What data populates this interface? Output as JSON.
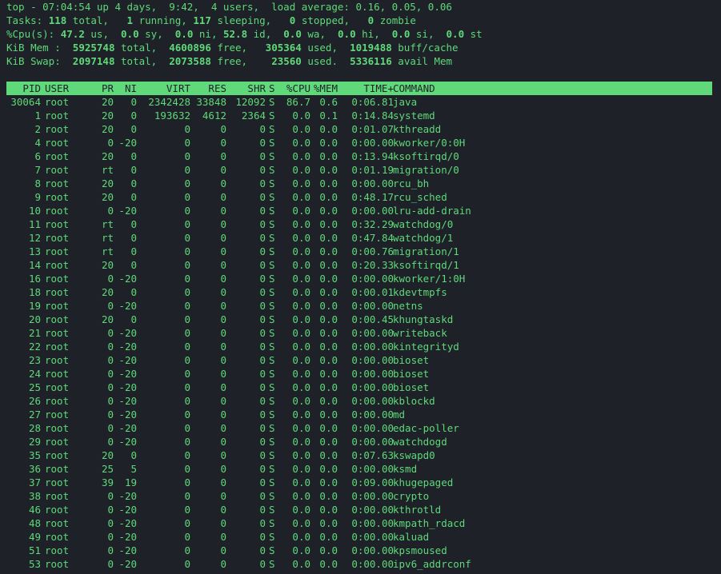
{
  "summary": {
    "uptime_line": "top - 07:04:54 up 4 days,  9:42,  4 users,  load average: 0.16, 0.05, 0.06",
    "tasks": {
      "label": "Tasks:",
      "total": "118",
      "total_label": "total,",
      "running": "1",
      "running_label": "running,",
      "sleeping": "117",
      "sleeping_label": "sleeping,",
      "stopped": "0",
      "stopped_label": "stopped,",
      "zombie": "0",
      "zombie_label": "zombie"
    },
    "cpu": {
      "label": "%Cpu(s):",
      "us": "47.2",
      "us_label": "us,",
      "sy": "0.0",
      "sy_label": "sy,",
      "ni": "0.0",
      "ni_label": "ni,",
      "id": "52.8",
      "id_label": "id,",
      "wa": "0.0",
      "wa_label": "wa,",
      "hi": "0.0",
      "hi_label": "hi,",
      "si": "0.0",
      "si_label": "si,",
      "st": "0.0",
      "st_label": "st"
    },
    "mem": {
      "label": "KiB Mem :",
      "total": "5925748",
      "total_label": "total,",
      "free": "4600896",
      "free_label": "free,",
      "used": "305364",
      "used_label": "used,",
      "buff": "1019488",
      "buff_label": "buff/cache"
    },
    "swap": {
      "label": "KiB Swap:",
      "total": "2097148",
      "total_label": "total,",
      "free": "2073588",
      "free_label": "free,",
      "used": "23560",
      "used_label": "used.",
      "avail": "5336116",
      "avail_label": "avail Mem"
    }
  },
  "columns": [
    "PID",
    "USER",
    "PR",
    "NI",
    "VIRT",
    "RES",
    "SHR",
    "S",
    "%CPU",
    "%MEM",
    "TIME+",
    "COMMAND"
  ],
  "processes": [
    [
      "30064",
      "root",
      "20",
      "0",
      "2342428",
      "33848",
      "12092",
      "S",
      "86.7",
      "0.6",
      "0:06.81",
      "java"
    ],
    [
      "1",
      "root",
      "20",
      "0",
      "193632",
      "4612",
      "2364",
      "S",
      "0.0",
      "0.1",
      "0:14.84",
      "systemd"
    ],
    [
      "2",
      "root",
      "20",
      "0",
      "0",
      "0",
      "0",
      "S",
      "0.0",
      "0.0",
      "0:01.07",
      "kthreadd"
    ],
    [
      "4",
      "root",
      "0",
      "-20",
      "0",
      "0",
      "0",
      "S",
      "0.0",
      "0.0",
      "0:00.00",
      "kworker/0:0H"
    ],
    [
      "6",
      "root",
      "20",
      "0",
      "0",
      "0",
      "0",
      "S",
      "0.0",
      "0.0",
      "0:13.94",
      "ksoftirqd/0"
    ],
    [
      "7",
      "root",
      "rt",
      "0",
      "0",
      "0",
      "0",
      "S",
      "0.0",
      "0.0",
      "0:01.19",
      "migration/0"
    ],
    [
      "8",
      "root",
      "20",
      "0",
      "0",
      "0",
      "0",
      "S",
      "0.0",
      "0.0",
      "0:00.00",
      "rcu_bh"
    ],
    [
      "9",
      "root",
      "20",
      "0",
      "0",
      "0",
      "0",
      "S",
      "0.0",
      "0.0",
      "0:48.17",
      "rcu_sched"
    ],
    [
      "10",
      "root",
      "0",
      "-20",
      "0",
      "0",
      "0",
      "S",
      "0.0",
      "0.0",
      "0:00.00",
      "lru-add-drain"
    ],
    [
      "11",
      "root",
      "rt",
      "0",
      "0",
      "0",
      "0",
      "S",
      "0.0",
      "0.0",
      "0:32.29",
      "watchdog/0"
    ],
    [
      "12",
      "root",
      "rt",
      "0",
      "0",
      "0",
      "0",
      "S",
      "0.0",
      "0.0",
      "0:47.84",
      "watchdog/1"
    ],
    [
      "13",
      "root",
      "rt",
      "0",
      "0",
      "0",
      "0",
      "S",
      "0.0",
      "0.0",
      "0:00.76",
      "migration/1"
    ],
    [
      "14",
      "root",
      "20",
      "0",
      "0",
      "0",
      "0",
      "S",
      "0.0",
      "0.0",
      "0:20.33",
      "ksoftirqd/1"
    ],
    [
      "16",
      "root",
      "0",
      "-20",
      "0",
      "0",
      "0",
      "S",
      "0.0",
      "0.0",
      "0:00.00",
      "kworker/1:0H"
    ],
    [
      "18",
      "root",
      "20",
      "0",
      "0",
      "0",
      "0",
      "S",
      "0.0",
      "0.0",
      "0:00.01",
      "kdevtmpfs"
    ],
    [
      "19",
      "root",
      "0",
      "-20",
      "0",
      "0",
      "0",
      "S",
      "0.0",
      "0.0",
      "0:00.00",
      "netns"
    ],
    [
      "20",
      "root",
      "20",
      "0",
      "0",
      "0",
      "0",
      "S",
      "0.0",
      "0.0",
      "0:00.45",
      "khungtaskd"
    ],
    [
      "21",
      "root",
      "0",
      "-20",
      "0",
      "0",
      "0",
      "S",
      "0.0",
      "0.0",
      "0:00.00",
      "writeback"
    ],
    [
      "22",
      "root",
      "0",
      "-20",
      "0",
      "0",
      "0",
      "S",
      "0.0",
      "0.0",
      "0:00.00",
      "kintegrityd"
    ],
    [
      "23",
      "root",
      "0",
      "-20",
      "0",
      "0",
      "0",
      "S",
      "0.0",
      "0.0",
      "0:00.00",
      "bioset"
    ],
    [
      "24",
      "root",
      "0",
      "-20",
      "0",
      "0",
      "0",
      "S",
      "0.0",
      "0.0",
      "0:00.00",
      "bioset"
    ],
    [
      "25",
      "root",
      "0",
      "-20",
      "0",
      "0",
      "0",
      "S",
      "0.0",
      "0.0",
      "0:00.00",
      "bioset"
    ],
    [
      "26",
      "root",
      "0",
      "-20",
      "0",
      "0",
      "0",
      "S",
      "0.0",
      "0.0",
      "0:00.00",
      "kblockd"
    ],
    [
      "27",
      "root",
      "0",
      "-20",
      "0",
      "0",
      "0",
      "S",
      "0.0",
      "0.0",
      "0:00.00",
      "md"
    ],
    [
      "28",
      "root",
      "0",
      "-20",
      "0",
      "0",
      "0",
      "S",
      "0.0",
      "0.0",
      "0:00.00",
      "edac-poller"
    ],
    [
      "29",
      "root",
      "0",
      "-20",
      "0",
      "0",
      "0",
      "S",
      "0.0",
      "0.0",
      "0:00.00",
      "watchdogd"
    ],
    [
      "35",
      "root",
      "20",
      "0",
      "0",
      "0",
      "0",
      "S",
      "0.0",
      "0.0",
      "0:07.63",
      "kswapd0"
    ],
    [
      "36",
      "root",
      "25",
      "5",
      "0",
      "0",
      "0",
      "S",
      "0.0",
      "0.0",
      "0:00.00",
      "ksmd"
    ],
    [
      "37",
      "root",
      "39",
      "19",
      "0",
      "0",
      "0",
      "S",
      "0.0",
      "0.0",
      "0:09.00",
      "khugepaged"
    ],
    [
      "38",
      "root",
      "0",
      "-20",
      "0",
      "0",
      "0",
      "S",
      "0.0",
      "0.0",
      "0:00.00",
      "crypto"
    ],
    [
      "46",
      "root",
      "0",
      "-20",
      "0",
      "0",
      "0",
      "S",
      "0.0",
      "0.0",
      "0:00.00",
      "kthrotld"
    ],
    [
      "48",
      "root",
      "0",
      "-20",
      "0",
      "0",
      "0",
      "S",
      "0.0",
      "0.0",
      "0:00.00",
      "kmpath_rdacd"
    ],
    [
      "49",
      "root",
      "0",
      "-20",
      "0",
      "0",
      "0",
      "S",
      "0.0",
      "0.0",
      "0:00.00",
      "kaluad"
    ],
    [
      "51",
      "root",
      "0",
      "-20",
      "0",
      "0",
      "0",
      "S",
      "0.0",
      "0.0",
      "0:00.00",
      "kpsmoused"
    ],
    [
      "53",
      "root",
      "0",
      "-20",
      "0",
      "0",
      "0",
      "S",
      "0.0",
      "0.0",
      "0:00.00",
      "ipv6_addrconf"
    ]
  ],
  "colors": {
    "background": "#1e2127",
    "text": "#5fd97a",
    "header_bg": "#5fd97a",
    "header_text": "#1e2127"
  }
}
